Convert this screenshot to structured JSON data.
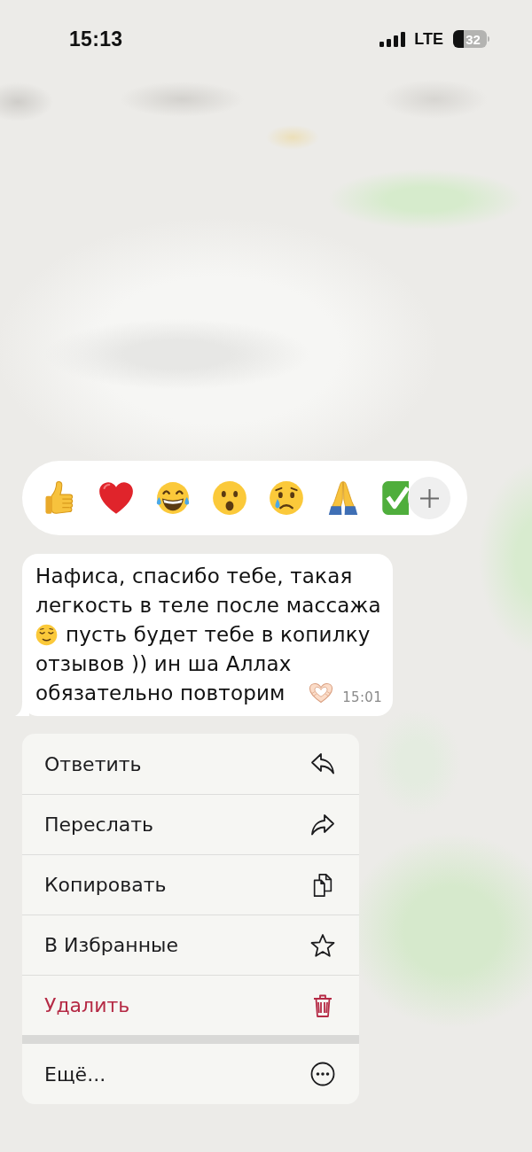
{
  "status_bar": {
    "time": "15:13",
    "network": "LTE",
    "battery": "32"
  },
  "message": {
    "text": "Нафиса, спасибо тебе, такая легкость в теле после массажа",
    "text_2": "пусть будет тебе в копилку",
    "text_3": "отзывов )) ин ша Аллах обязательно повторим",
    "time": "15:01"
  },
  "context_menu": {
    "sections": [
      {
        "items": [
          {
            "label": "Ответить",
            "kind": "reply",
            "destructive": false
          },
          {
            "label": "Переслать",
            "kind": "forward",
            "destructive": false
          },
          {
            "label": "Копировать",
            "kind": "copy",
            "destructive": false
          },
          {
            "label": "В Избранные",
            "kind": "favorite",
            "destructive": false
          },
          {
            "label": "Удалить",
            "kind": "delete",
            "destructive": true
          }
        ]
      },
      {
        "items": [
          {
            "label": "Ещё...",
            "kind": "more",
            "destructive": false
          }
        ]
      }
    ]
  }
}
